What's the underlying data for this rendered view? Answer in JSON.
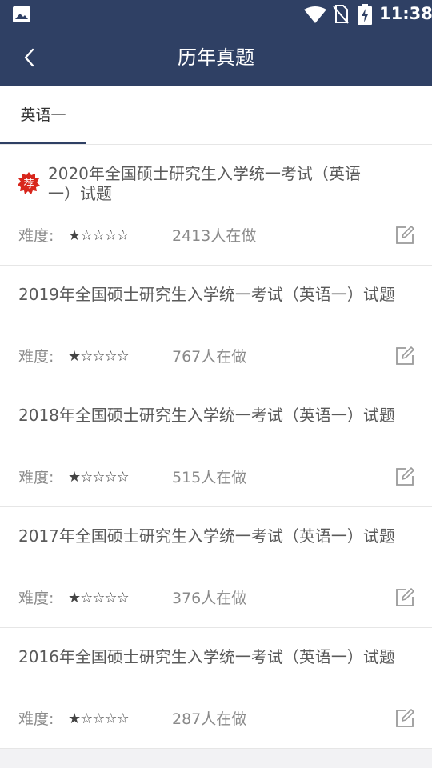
{
  "status_bar": {
    "time": "11:38"
  },
  "header": {
    "title": "历年真题"
  },
  "tabs": [
    {
      "label": "英语一",
      "active": true
    }
  ],
  "accent_color": "#2f4064",
  "difficulty_label": "难度:",
  "papers": [
    {
      "title": "2020年全国硕士研究生入学统一考试（英语一）试题",
      "badge": "荐",
      "stars": "★☆☆☆☆",
      "rating": 1,
      "count": "2413人在做"
    },
    {
      "title": "2019年全国硕士研究生入学统一考试（英语一）试题",
      "stars": "★☆☆☆☆",
      "rating": 1,
      "count": "767人在做"
    },
    {
      "title": "2018年全国硕士研究生入学统一考试（英语一）试题",
      "stars": "★☆☆☆☆",
      "rating": 1,
      "count": "515人在做"
    },
    {
      "title": "2017年全国硕士研究生入学统一考试（英语一）试题",
      "stars": "★☆☆☆☆",
      "rating": 1,
      "count": "376人在做"
    },
    {
      "title": "2016年全国硕士研究生入学统一考试（英语一）试题",
      "stars": "★☆☆☆☆",
      "rating": 1,
      "count": "287人在做"
    }
  ]
}
